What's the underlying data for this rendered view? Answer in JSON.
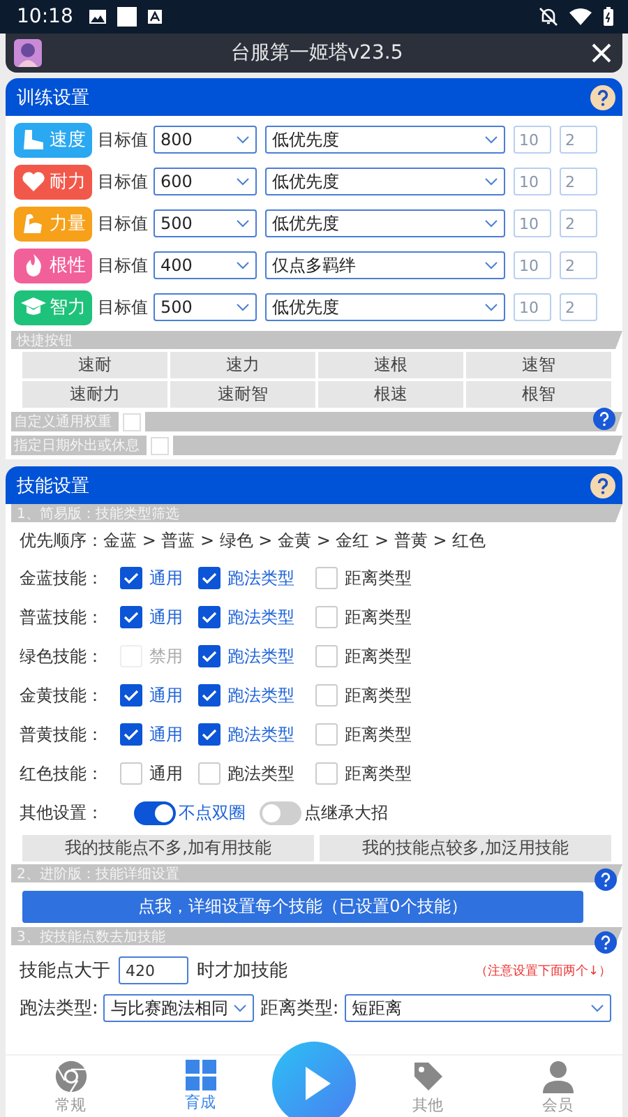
{
  "status_bar": {
    "time": "10:18"
  },
  "window": {
    "title": "台服第一姬塔v23.5"
  },
  "training": {
    "title": "训练设置",
    "rows": [
      {
        "stat": "速度",
        "kind": "shoe",
        "color": "#2aa8f2",
        "target_label": "目标值",
        "target": "800",
        "priority": "低优先度",
        "field_a": "10",
        "field_b": "2"
      },
      {
        "stat": "耐力",
        "kind": "heart",
        "color": "#f2584a",
        "target_label": "目标值",
        "target": "600",
        "priority": "低优先度",
        "field_a": "10",
        "field_b": "2"
      },
      {
        "stat": "力量",
        "kind": "muscle",
        "color": "#f7a01a",
        "target_label": "目标值",
        "target": "500",
        "priority": "低优先度",
        "field_a": "10",
        "field_b": "2"
      },
      {
        "stat": "根性",
        "kind": "fire",
        "color": "#f2609a",
        "target_label": "目标值",
        "target": "400",
        "priority": "仅点多羁绊",
        "field_a": "10",
        "field_b": "2"
      },
      {
        "stat": "智力",
        "kind": "cap",
        "color": "#1fc27a",
        "target_label": "目标值",
        "target": "500",
        "priority": "低优先度",
        "field_a": "10",
        "field_b": "2"
      }
    ],
    "quick_label": "快捷按钮",
    "quick_buttons": [
      "速耐",
      "速力",
      "速根",
      "速智",
      "速耐力",
      "速耐智",
      "根速",
      "根智"
    ],
    "custom_weight": {
      "label": "自定义通用权重",
      "checked": false
    },
    "date_rest": {
      "label": "指定日期外出或休息",
      "checked": false
    }
  },
  "skills": {
    "title": "技能设置",
    "simple_label": "1、简易版：技能类型筛选",
    "priority_order": "优先顺序：金蓝 > 普蓝 > 绿色 > 金黄 > 金红 > 普黄 > 红色",
    "rows": [
      {
        "label": "金蓝技能：",
        "options": [
          {
            "label": "通用",
            "checked": true,
            "disabled": false
          },
          {
            "label": "跑法类型",
            "checked": true,
            "disabled": false
          },
          {
            "label": "距离类型",
            "checked": false,
            "disabled": false
          }
        ]
      },
      {
        "label": "普蓝技能：",
        "options": [
          {
            "label": "通用",
            "checked": true,
            "disabled": false
          },
          {
            "label": "跑法类型",
            "checked": true,
            "disabled": false
          },
          {
            "label": "距离类型",
            "checked": false,
            "disabled": false
          }
        ]
      },
      {
        "label": "绿色技能：",
        "options": [
          {
            "label": "禁用",
            "checked": false,
            "disabled": true
          },
          {
            "label": "跑法类型",
            "checked": true,
            "disabled": false
          },
          {
            "label": "距离类型",
            "checked": false,
            "disabled": false
          }
        ]
      },
      {
        "label": "金黄技能：",
        "options": [
          {
            "label": "通用",
            "checked": true,
            "disabled": false
          },
          {
            "label": "跑法类型",
            "checked": true,
            "disabled": false
          },
          {
            "label": "距离类型",
            "checked": false,
            "disabled": false
          }
        ]
      },
      {
        "label": "普黄技能：",
        "options": [
          {
            "label": "通用",
            "checked": true,
            "disabled": false
          },
          {
            "label": "跑法类型",
            "checked": true,
            "disabled": false
          },
          {
            "label": "距离类型",
            "checked": false,
            "disabled": false
          }
        ]
      },
      {
        "label": "红色技能：",
        "options": [
          {
            "label": "通用",
            "checked": false,
            "disabled": false
          },
          {
            "label": "跑法类型",
            "checked": false,
            "disabled": false
          },
          {
            "label": "距离类型",
            "checked": false,
            "disabled": false
          }
        ]
      }
    ],
    "other_label": "其他设置：",
    "toggles": [
      {
        "label": "不点双圈",
        "on": true
      },
      {
        "label": "点继承大招",
        "on": false
      }
    ],
    "preset_buttons": [
      "我的技能点不多,加有用技能",
      "我的技能点较多,加泛用技能"
    ],
    "advanced_label": "2、进阶版：技能详细设置",
    "detail_button": "点我，详细设置每个技能（已设置0个技能）",
    "points_label": "3、按技能点数去加技能",
    "points_prefix": "技能点大于",
    "points_value": "420",
    "points_suffix": "时才加技能",
    "points_note": "（注意设置下面两个↓）",
    "selects": [
      {
        "label": "跑法类型:",
        "value": "与比赛跑法相同"
      },
      {
        "label": "距离类型:",
        "value": "短距离"
      }
    ]
  },
  "nav": {
    "items": [
      {
        "label": "常规",
        "kind": "chrome",
        "selected": false
      },
      {
        "label": "育成",
        "kind": "grid",
        "selected": true
      },
      {
        "label": "其他",
        "kind": "tag",
        "selected": false
      },
      {
        "label": "会员",
        "kind": "person",
        "selected": false
      }
    ]
  }
}
